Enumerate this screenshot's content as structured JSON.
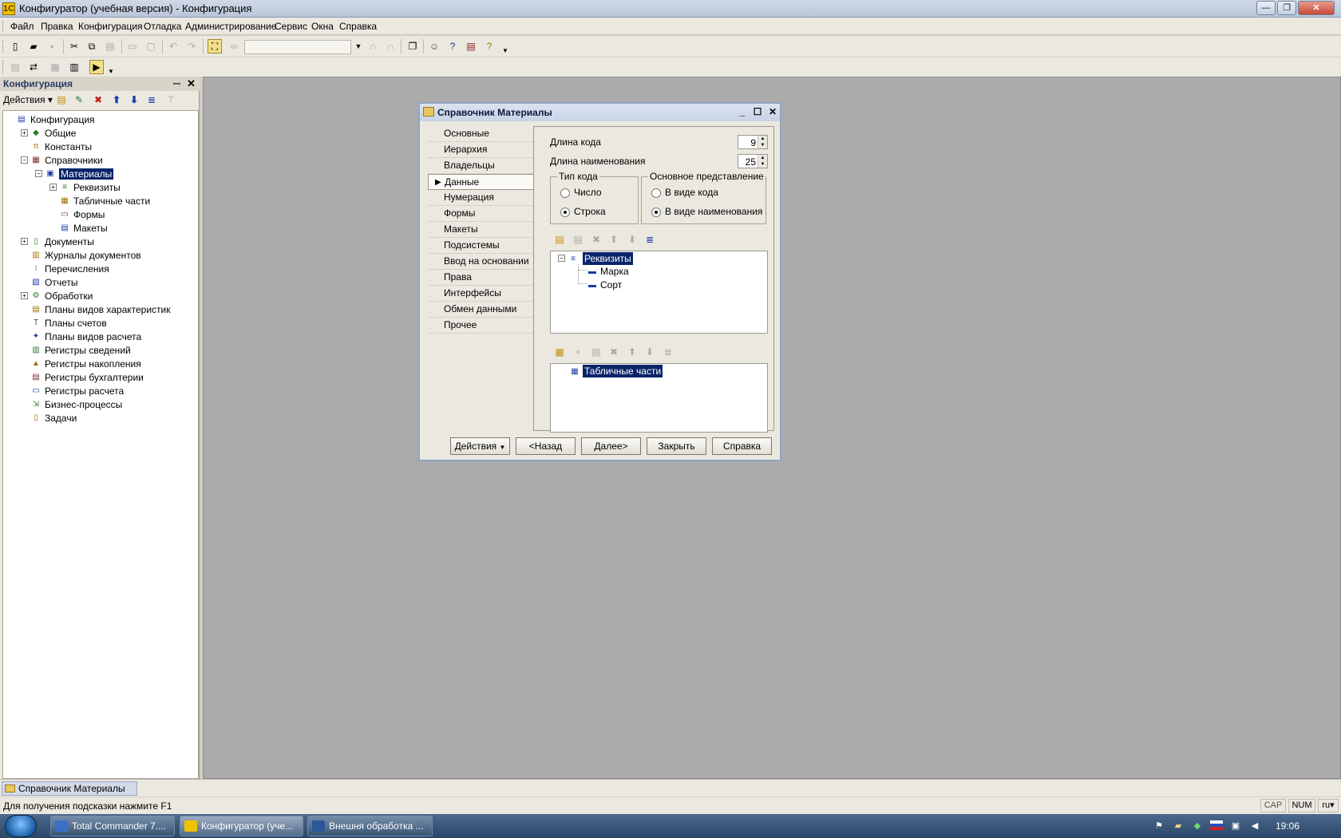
{
  "window": {
    "title": "Конфигуратор (учебная версия) - Конфигурация",
    "min_glyph": "—",
    "max_glyph": "❐",
    "close_glyph": "✕"
  },
  "menu": [
    "Файл",
    "Правка",
    "Конфигурация",
    "Отладка",
    "Администрирование",
    "Сервис",
    "Окна",
    "Справка"
  ],
  "left_panel": {
    "title": "Конфигурация",
    "pin": "ꟷ",
    "close": "✕",
    "actions_label": "Действия",
    "tree": [
      {
        "label": "Конфигурация",
        "level": 0,
        "exp": "",
        "icon": "config-icon",
        "glyph": "▤"
      },
      {
        "label": "Общие",
        "level": 1,
        "exp": "+",
        "icon": "common-icon",
        "glyph": "◆"
      },
      {
        "label": "Константы",
        "level": 1,
        "exp": "",
        "icon": "constants-icon",
        "glyph": "π"
      },
      {
        "label": "Справочники",
        "level": 1,
        "exp": "−",
        "icon": "catalogs-icon",
        "glyph": "▦"
      },
      {
        "label": "Материалы",
        "level": 2,
        "exp": "−",
        "icon": "catalog-icon",
        "glyph": "▣",
        "selected": true
      },
      {
        "label": "Реквизиты",
        "level": 3,
        "exp": "+",
        "icon": "attributes-icon",
        "glyph": "≡"
      },
      {
        "label": "Табличные части",
        "level": 3,
        "exp": "",
        "icon": "tabular-icon",
        "glyph": "▦"
      },
      {
        "label": "Формы",
        "level": 3,
        "exp": "",
        "icon": "forms-icon",
        "glyph": "▭"
      },
      {
        "label": "Макеты",
        "level": 3,
        "exp": "",
        "icon": "templates-icon",
        "glyph": "▤"
      },
      {
        "label": "Документы",
        "level": 1,
        "exp": "+",
        "icon": "documents-icon",
        "glyph": "▯"
      },
      {
        "label": "Журналы документов",
        "level": 1,
        "exp": "",
        "icon": "journals-icon",
        "glyph": "▥"
      },
      {
        "label": "Перечисления",
        "level": 1,
        "exp": "",
        "icon": "enums-icon",
        "glyph": "⁝"
      },
      {
        "label": "Отчеты",
        "level": 1,
        "exp": "",
        "icon": "reports-icon",
        "glyph": "▧"
      },
      {
        "label": "Обработки",
        "level": 1,
        "exp": "+",
        "icon": "processing-icon",
        "glyph": "⚙"
      },
      {
        "label": "Планы видов характеристик",
        "level": 1,
        "exp": "",
        "icon": "char-types-icon",
        "glyph": "▤"
      },
      {
        "label": "Планы счетов",
        "level": 1,
        "exp": "",
        "icon": "chart-of-accounts-icon",
        "glyph": "T"
      },
      {
        "label": "Планы видов расчета",
        "level": 1,
        "exp": "",
        "icon": "calc-types-icon",
        "glyph": "✦"
      },
      {
        "label": "Регистры сведений",
        "level": 1,
        "exp": "",
        "icon": "info-registers-icon",
        "glyph": "▥"
      },
      {
        "label": "Регистры накопления",
        "level": 1,
        "exp": "",
        "icon": "accum-registers-icon",
        "glyph": "▲"
      },
      {
        "label": "Регистры бухгалтерии",
        "level": 1,
        "exp": "",
        "icon": "accounting-registers-icon",
        "glyph": "▤"
      },
      {
        "label": "Регистры расчета",
        "level": 1,
        "exp": "",
        "icon": "calc-registers-icon",
        "glyph": "▭"
      },
      {
        "label": "Бизнес-процессы",
        "level": 1,
        "exp": "",
        "icon": "business-process-icon",
        "glyph": "⇲"
      },
      {
        "label": "Задачи",
        "level": 1,
        "exp": "",
        "icon": "tasks-icon",
        "glyph": "▯"
      }
    ]
  },
  "dialog": {
    "title": "Справочник Материалы",
    "tabs": [
      "Основные",
      "Иерархия",
      "Владельцы",
      "Данные",
      "Нумерация",
      "Формы",
      "Макеты",
      "Подсистемы",
      "Ввод на основании",
      "Права",
      "Интерфейсы",
      "Обмен данными",
      "Прочее"
    ],
    "active_tab": "Данные",
    "code_length_label": "Длина кода",
    "code_length_value": "9",
    "name_length_label": "Длина наименования",
    "name_length_value": "25",
    "code_type": {
      "title": "Тип кода",
      "options": [
        "Число",
        "Строка"
      ],
      "selected": "Строка"
    },
    "main_repr": {
      "title": "Основное представление",
      "options": [
        "В виде кода",
        "В виде наименования"
      ],
      "selected": "В виде наименования"
    },
    "attributes_root": "Реквизиты",
    "attributes": [
      "Марка",
      "Сорт"
    ],
    "tabular_root": "Табличные части",
    "buttons": {
      "actions": "Действия",
      "back": "<Назад",
      "next": "Далее>",
      "close": "Закрыть",
      "help": "Справка"
    }
  },
  "window_bar": {
    "tab": "Справочник Материалы"
  },
  "status": {
    "hint": "Для получения подсказки нажмите F1",
    "cap": "CAP",
    "num": "NUM",
    "lang": "ru"
  },
  "taskbar": {
    "items": [
      {
        "label": "Total Commander 7....",
        "icon": "total-commander-icon",
        "color": "#3c6fc9"
      },
      {
        "label": "Конфигуратор (уче...",
        "icon": "configurator-icon",
        "color": "#f2c200"
      },
      {
        "label": "Внешня обработка ...",
        "icon": "word-icon",
        "color": "#2b579a"
      }
    ],
    "clock": "19:06"
  }
}
